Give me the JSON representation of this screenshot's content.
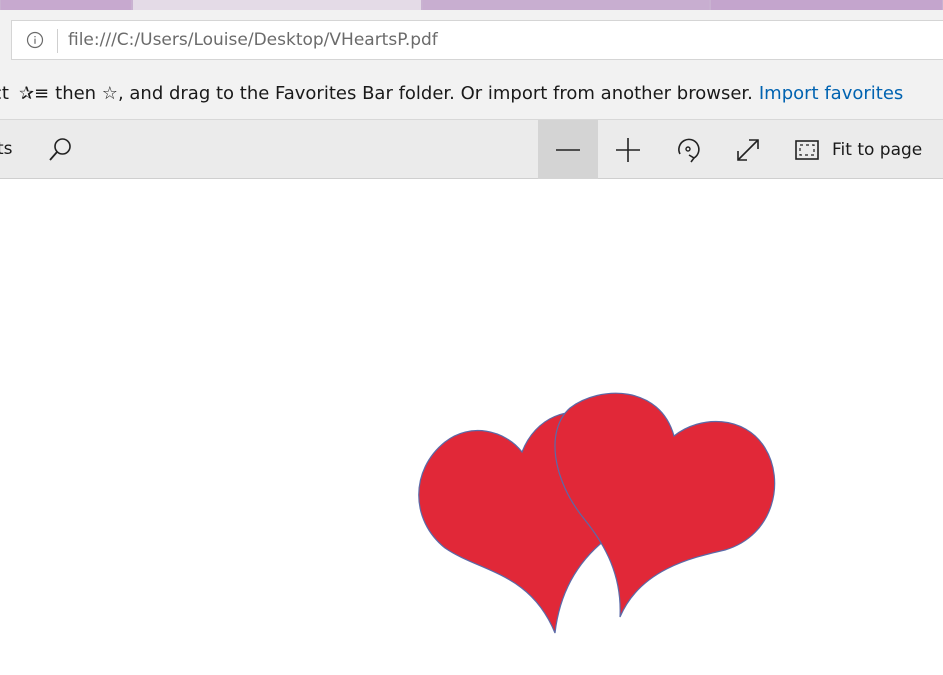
{
  "tabs": [
    {
      "label": ""
    },
    {
      "label": ""
    },
    {
      "label": ""
    },
    {
      "label": ""
    }
  ],
  "address": {
    "url": "file:///C:/Users/Louise/Desktop/VHeartsP.pdf",
    "info_icon": "info-icon"
  },
  "favorites_bar": {
    "lead_text": "ct",
    "hint_text": "then ☆, and drag to the Favorites Bar folder. Or import from another browser.",
    "import_label": "Import favorites",
    "link_color": "#0063b1"
  },
  "pdf_toolbar": {
    "cut_label": "ts",
    "fit_label": "Fit to page",
    "icons": [
      "search-icon",
      "zoom-out-icon",
      "zoom-in-icon",
      "rotate-icon",
      "fullscreen-icon",
      "fit-to-page-icon"
    ]
  },
  "document": {
    "heart_fill": "#e12838",
    "heart_stroke": "#5b6aa8"
  }
}
